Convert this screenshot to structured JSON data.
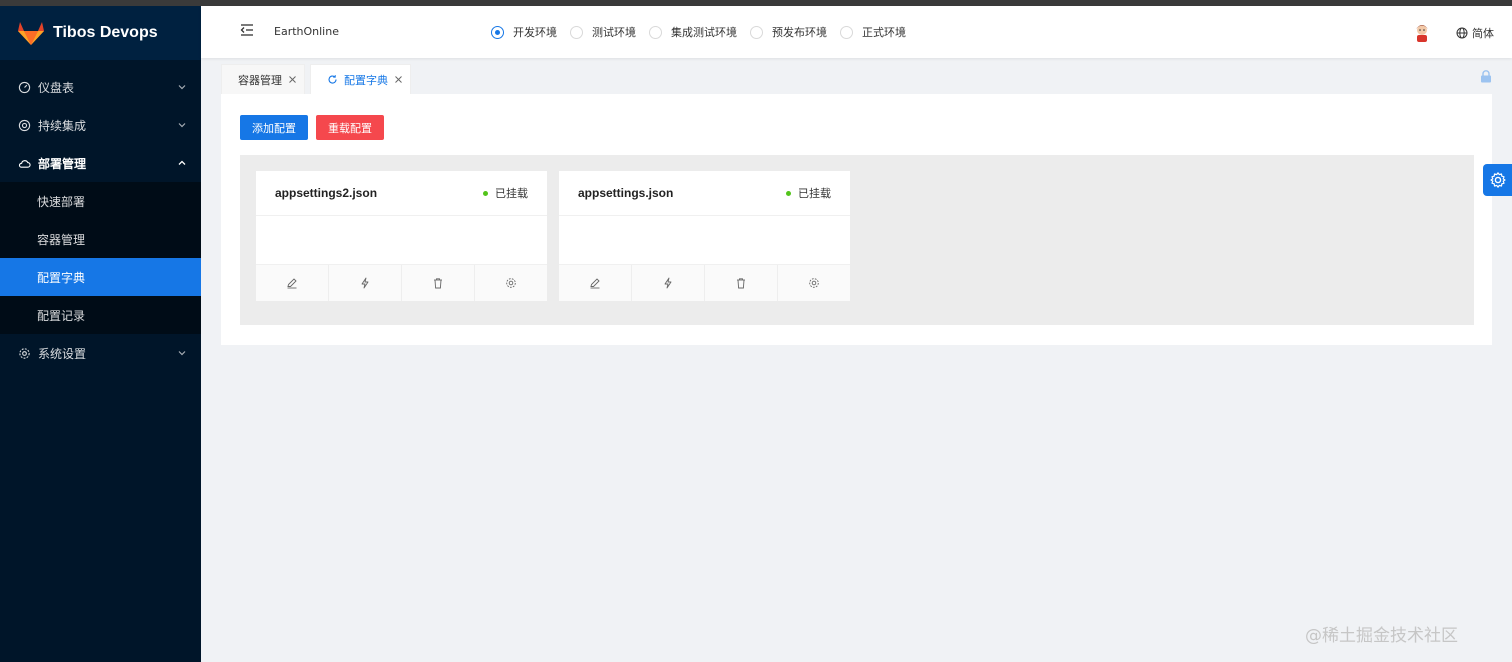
{
  "app": {
    "title": "Tibos Devops"
  },
  "sidebar": {
    "menu": [
      {
        "label": "仪盘表"
      },
      {
        "label": "持续集成"
      },
      {
        "label": "部署管理"
      },
      {
        "label": "系统设置"
      }
    ],
    "submenu": [
      {
        "label": "快速部署"
      },
      {
        "label": "容器管理"
      },
      {
        "label": "配置字典"
      },
      {
        "label": "配置记录"
      }
    ]
  },
  "header": {
    "project": "EarthOnline",
    "environments": [
      {
        "label": "开发环境",
        "checked": true
      },
      {
        "label": "测试环境"
      },
      {
        "label": "集成测试环境"
      },
      {
        "label": "预发布环境"
      },
      {
        "label": "正式环境"
      }
    ],
    "language": "简体"
  },
  "tabs": [
    {
      "label": "容器管理"
    },
    {
      "label": "配置字典"
    }
  ],
  "toolbar": {
    "add_label": "添加配置",
    "reload_label": "重载配置"
  },
  "configs": [
    {
      "name": "appsettings2.json",
      "status": "已挂载"
    },
    {
      "name": "appsettings.json",
      "status": "已挂载"
    }
  ],
  "watermark": "@稀土掘金技术社区",
  "colors": {
    "primary": "#1677e6",
    "danger": "#f5484d",
    "sidebar_bg": "#001529",
    "status_ok": "#52c41a"
  }
}
